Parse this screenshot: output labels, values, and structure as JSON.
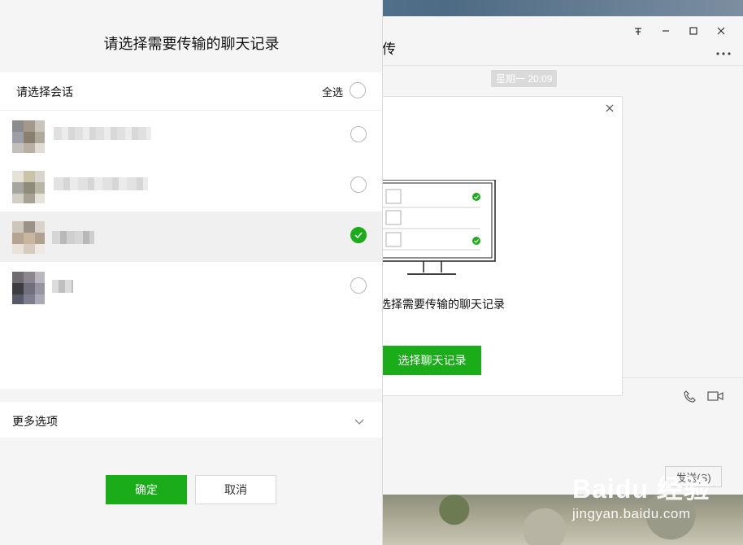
{
  "dialog": {
    "title": "请选择需要传输的聊天记录",
    "select_label": "请选择会话",
    "select_all_label": "全选",
    "select_all_checked": false,
    "conversations": [
      {
        "name": "",
        "selected": false
      },
      {
        "name": "",
        "selected": false
      },
      {
        "name": "",
        "selected": true
      },
      {
        "name": "",
        "selected": false
      }
    ],
    "more_options_label": "更多选项",
    "confirm_label": "确定",
    "cancel_label": "取消"
  },
  "chat_window": {
    "title": "传",
    "pin_icon": "pin-icon",
    "minimize_icon": "minimize-icon",
    "maximize_icon": "maximize-icon",
    "close_icon": "close-icon",
    "more_icon": "more-icon",
    "timestamp": "星期一 20:09",
    "send_label": "发送(S)"
  },
  "migration_card": {
    "caption": "选择需要传输的聊天记录",
    "button_label": "选择聊天记录"
  },
  "watermark": {
    "main": "Baidu 经验",
    "sub": "jingyan.baidu.com"
  },
  "colors": {
    "accent": "#1aad19",
    "dialog_bg": "#f5f5f5",
    "list_bg": "#ffffff",
    "selected_row": "#f0f0f0"
  }
}
